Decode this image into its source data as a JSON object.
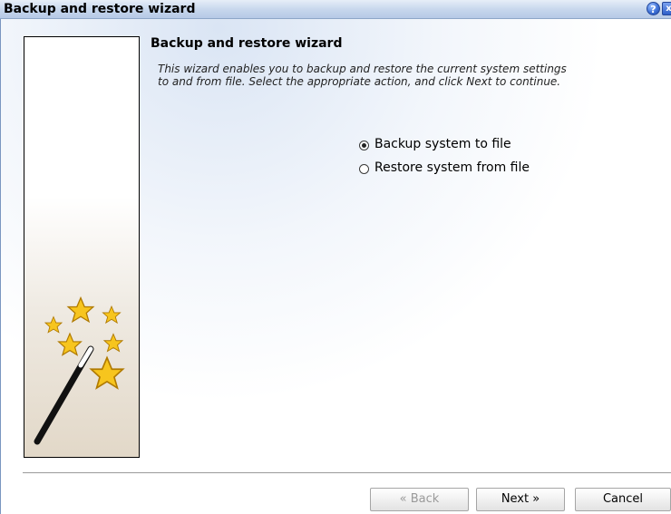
{
  "window": {
    "title": "Backup and restore wizard",
    "help_glyph": "?",
    "close_glyph": "x"
  },
  "page": {
    "heading": "Backup and restore wizard",
    "description": "This wizard enables you to backup and restore the current system settings\nto and from file. Select the appropriate action, and click Next to continue."
  },
  "options": [
    {
      "label": "Backup system to file",
      "selected": true
    },
    {
      "label": "Restore system from file",
      "selected": false
    }
  ],
  "buttons": {
    "back": "« Back",
    "next": "Next »",
    "cancel": "Cancel"
  },
  "icons": {
    "help": "help-icon",
    "close": "close-icon",
    "wizard_art": "magic-wand-stars-icon"
  },
  "colors": {
    "titlebar": "#c6d6ec",
    "star_fill": "#f7c51e",
    "star_stroke": "#b07a00"
  }
}
